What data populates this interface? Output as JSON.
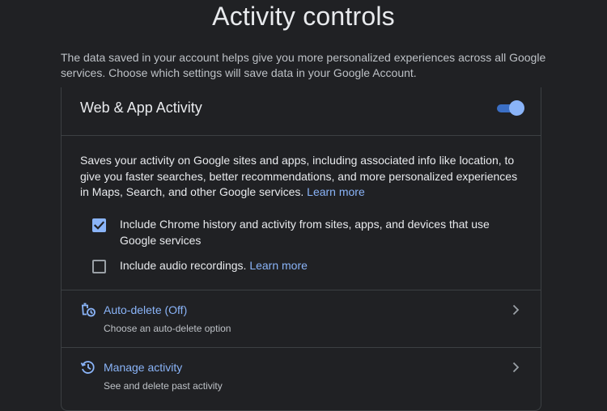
{
  "page": {
    "title": "Activity controls",
    "intro": "The data saved in your account helps give you more personalized experiences across all Google services. Choose which settings will save data in your Google Account."
  },
  "web_app_activity": {
    "title": "Web & App Activity",
    "enabled": true,
    "description": "Saves your activity on Google sites and apps, including associated info like location, to give you faster searches, better recommendations, and more personalized experiences in Maps, Search, and other Google services.",
    "learn_more": "Learn more",
    "options": [
      {
        "label": "Include Chrome history and activity from sites, apps, and devices that use Google services",
        "checked": true
      },
      {
        "label": "Include audio recordings.",
        "learn_more": "Learn more",
        "checked": false
      }
    ]
  },
  "actions": [
    {
      "title": "Auto-delete (Off)",
      "subtitle": "Choose an auto-delete option",
      "icon": "auto-delete-icon"
    },
    {
      "title": "Manage activity",
      "subtitle": "See and delete past activity",
      "icon": "history-icon"
    }
  ],
  "colors": {
    "background": "#202124",
    "accent": "#8ab4f8",
    "toggle_track": "#3b6fc5",
    "divider": "#3c4043"
  }
}
